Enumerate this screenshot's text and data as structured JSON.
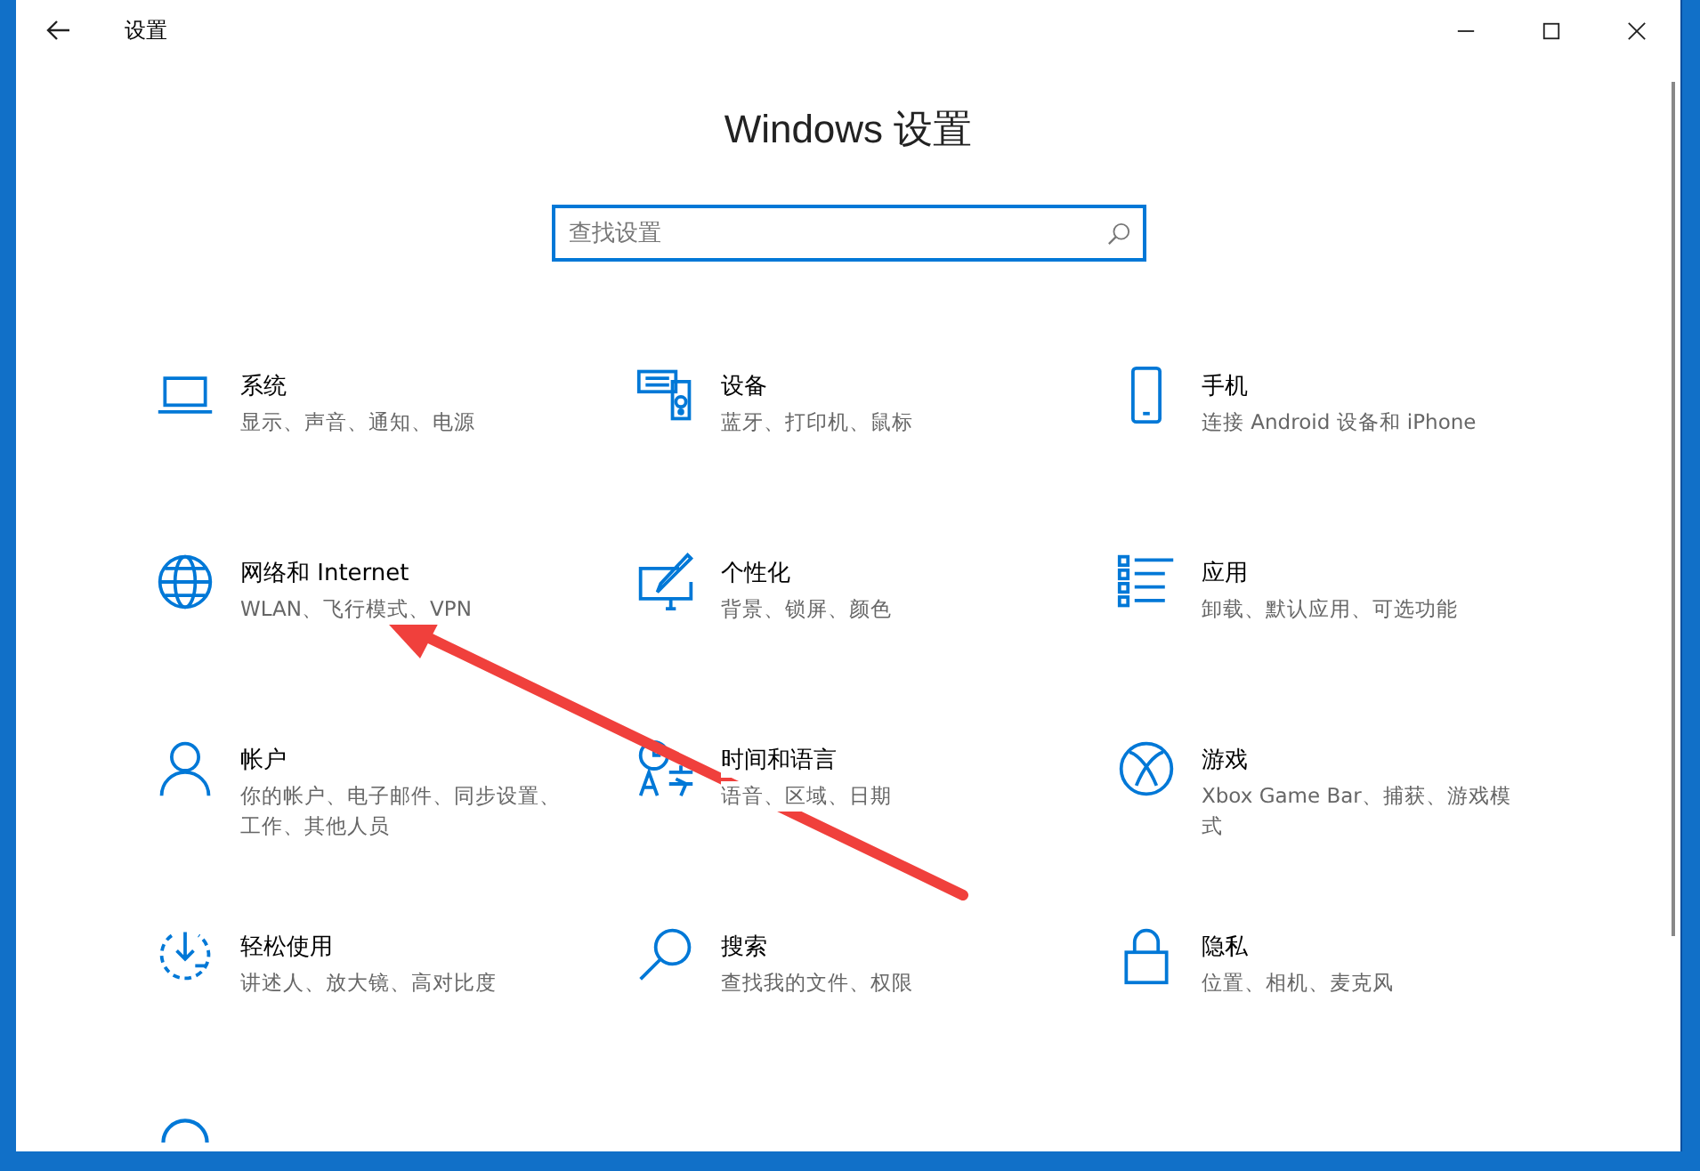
{
  "window": {
    "title": "设置"
  },
  "heading": "Windows 设置",
  "search": {
    "placeholder": "查找设置"
  },
  "tiles": [
    {
      "title": "系统",
      "subtitle": "显示、声音、通知、电源"
    },
    {
      "title": "设备",
      "subtitle": "蓝牙、打印机、鼠标"
    },
    {
      "title": "手机",
      "subtitle": "连接 Android 设备和 iPhone"
    },
    {
      "title": "网络和 Internet",
      "subtitle": "WLAN、飞行模式、VPN"
    },
    {
      "title": "个性化",
      "subtitle": "背景、锁屏、颜色"
    },
    {
      "title": "应用",
      "subtitle": "卸载、默认应用、可选功能"
    },
    {
      "title": "帐户",
      "subtitle": "你的帐户、电子邮件、同步设置、工作、其他人员"
    },
    {
      "title": "时间和语言",
      "subtitle": "语音、区域、日期"
    },
    {
      "title": "游戏",
      "subtitle": "Xbox Game Bar、捕获、游戏模式"
    },
    {
      "title": "轻松使用",
      "subtitle": "讲述人、放大镜、高对比度"
    },
    {
      "title": "搜索",
      "subtitle": "查找我的文件、权限"
    },
    {
      "title": "隐私",
      "subtitle": "位置、相机、麦克风"
    }
  ]
}
